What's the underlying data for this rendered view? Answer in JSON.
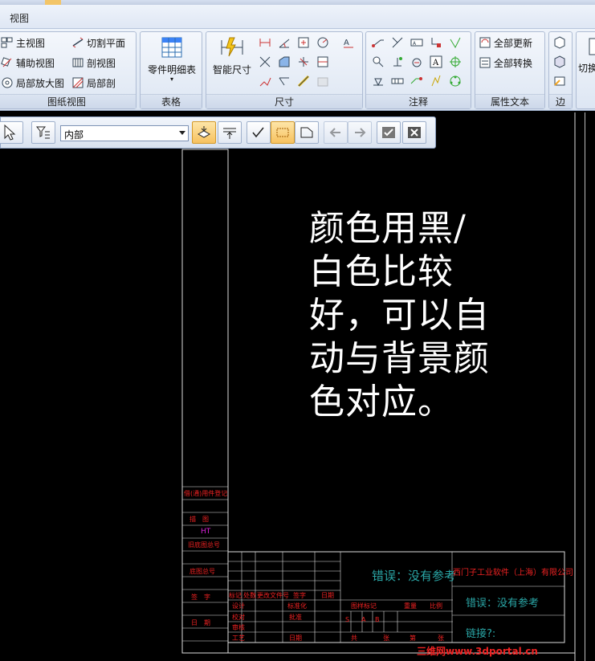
{
  "menu": {
    "view_label": "视图"
  },
  "ribbon": {
    "groups": [
      {
        "title": "图纸视图",
        "items": [
          "主视图",
          "辅助视图",
          "局部放大图",
          "切割平面",
          "剖视图",
          "局部剖"
        ]
      },
      {
        "title": "表格",
        "items": [
          "零件明细表"
        ]
      },
      {
        "title": "尺寸",
        "items": [
          "智能尺寸"
        ]
      },
      {
        "title": "注释",
        "items": []
      },
      {
        "title": "属性文本",
        "items": [
          "全部更新",
          "全部转换"
        ]
      },
      {
        "title": "边",
        "items": []
      },
      {
        "title": "",
        "items": [
          "切换"
        ]
      }
    ]
  },
  "toolbar": {
    "scope_select": "内部"
  },
  "drawing": {
    "note_lines": [
      "颜色用黑/",
      "白色比较",
      "好，可以自",
      "动与背景颜",
      "色对应。"
    ],
    "error1": "错误：没有参考",
    "error2": "错误：没有参考",
    "link": "链接?:",
    "company": "西门子工业软件（上海）有限公司",
    "left_labels": [
      "借(通)用件登记",
      "描　图",
      "HT",
      "旧底图总号",
      "底图总号",
      "签　字",
      "日　期"
    ],
    "title_block": {
      "row_labels": [
        "标记",
        "处数",
        "更改文件号",
        "签字",
        "日期"
      ],
      "roles": [
        "设计",
        "校对",
        "审核",
        "工艺"
      ],
      "right_labels": [
        "标准化",
        "批准",
        "日期"
      ],
      "table_headers": [
        "图样标记",
        "重量",
        "比例"
      ],
      "sheet_labels": [
        "共",
        "张",
        "第",
        "张"
      ],
      "stage_marks": [
        "S",
        "A",
        "B"
      ]
    },
    "watermark": "三维网www.3dportal.cn"
  },
  "colors": {
    "background": "#000000",
    "note": "#ffffff",
    "error": "#2aa6a6",
    "title_block": "#e22222"
  }
}
